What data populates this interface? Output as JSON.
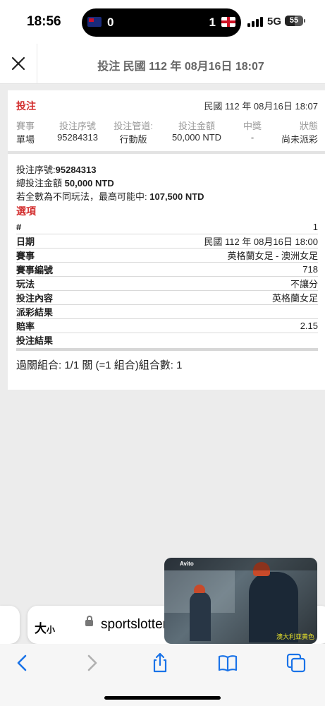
{
  "status_bar": {
    "time": "18:56",
    "score_left": "0",
    "score_right": "1",
    "network": "5G",
    "battery": "55"
  },
  "header": {
    "title": "投注 民國 112 年 08月16日 18:07"
  },
  "bet": {
    "label": "投注",
    "date": "民國 112 年 08月16日 18:07",
    "columns": [
      "賽事",
      "投注序號",
      "投注管道:",
      "投注金額",
      "中獎",
      "狀態"
    ],
    "values": [
      "單場",
      "95284313",
      "行動版",
      "50,000 NTD",
      "-",
      "尚未派彩"
    ]
  },
  "details": {
    "serial_label": "投注序號:",
    "serial": "95284313",
    "total_label": "總投注金額",
    "total": "50,000 NTD",
    "max_label": "若全數為不同玩法，最高可能中:",
    "max": "107,500 NTD"
  },
  "options": {
    "label": "選項",
    "rows": [
      {
        "key": "#",
        "value": "1"
      },
      {
        "key": "日期",
        "value": "民國 112 年 08月16日 18:00"
      },
      {
        "key": "賽事",
        "value": "英格蘭女足 - 澳洲女足"
      },
      {
        "key": "賽事編號",
        "value": "718"
      },
      {
        "key": "玩法",
        "value": "不讓分"
      },
      {
        "key": "投注內容",
        "value": "英格蘭女足"
      },
      {
        "key": "派彩結果",
        "value": ""
      },
      {
        "key": "賠率",
        "value": "2.15"
      },
      {
        "key": "投注結果",
        "value": ""
      }
    ]
  },
  "summary": "過關組合: 1/1 關 (=1 組合)組合數: 1",
  "browser": {
    "text_size_label": "大",
    "text_size_small": "小",
    "url": "sportslottery"
  },
  "pip": {
    "brand": "Avito",
    "caption": "澳大利亚黄色"
  }
}
